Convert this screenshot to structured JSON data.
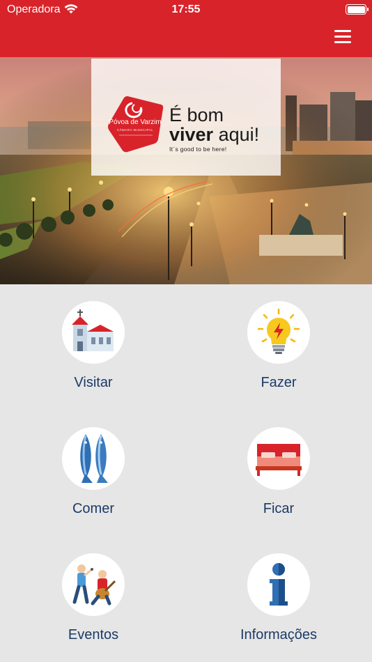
{
  "status_bar": {
    "carrier": "Operadora",
    "time": "17:55"
  },
  "header": {
    "menu_icon": "hamburger-menu-icon"
  },
  "hero": {
    "logo_name": "Póvoa de Varzim",
    "logo_sub": "CÂMARA MUNICIPAL",
    "tagline_line1": "É bom",
    "tagline_bold": "viver",
    "tagline_rest": " aqui!",
    "tagline_en": "It´s good to be here!"
  },
  "menu": [
    {
      "label": "Visitar",
      "icon": "church-icon"
    },
    {
      "label": "Fazer",
      "icon": "lightbulb-icon"
    },
    {
      "label": "Comer",
      "icon": "fish-icon"
    },
    {
      "label": "Ficar",
      "icon": "bed-icon"
    },
    {
      "label": "Eventos",
      "icon": "musicians-icon"
    },
    {
      "label": "Informações",
      "icon": "info-icon"
    }
  ],
  "colors": {
    "brand": "#d8232a",
    "label": "#1b3a66",
    "background": "#e6e6e6"
  }
}
